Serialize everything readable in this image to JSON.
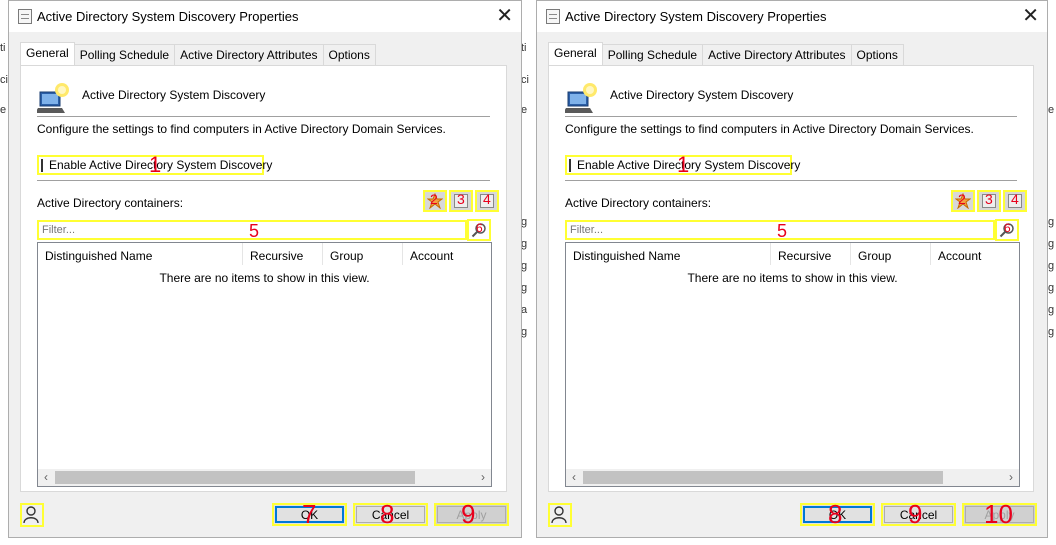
{
  "dialog1": {
    "title": "Active Directory System Discovery Properties",
    "close": "✕",
    "tabs": [
      "General",
      "Polling Schedule",
      "Active Directory Attributes",
      "Options"
    ],
    "header_label": "Active Directory System Discovery",
    "description": "Configure the settings to find computers in Active Directory Domain Services.",
    "enable_label": "Enable Active Directory System Discovery",
    "containers_label": "Active Directory containers:",
    "filter_placeholder": "Filter...",
    "columns": [
      "Distinguished Name",
      "Recursive",
      "Group",
      "Account"
    ],
    "empty_message": "There are no items to show in this view.",
    "buttons": {
      "ok": "OK",
      "cancel": "Cancel",
      "apply": "Apply"
    },
    "markers": {
      "enable": "1",
      "new": "2",
      "edit": "3",
      "delete": "4",
      "filter": "5",
      "search": "6",
      "ok": "7",
      "cancel": "8",
      "apply": "9"
    }
  },
  "dialog2": {
    "title": "Active Directory System Discovery Properties",
    "close": "✕",
    "tabs": [
      "General",
      "Polling Schedule",
      "Active Directory Attributes",
      "Options"
    ],
    "header_label": "Active Directory System Discovery",
    "description": "Configure the settings to find computers in Active Directory Domain Services.",
    "enable_label": "Enable Active Directory System Discovery",
    "containers_label": "Active Directory containers:",
    "filter_placeholder": "Filter...",
    "columns": [
      "Distinguished Name",
      "Recursive",
      "Group",
      "Account"
    ],
    "empty_message": "There are no items to show in this view.",
    "buttons": {
      "ok": "OK",
      "cancel": "Cancel",
      "apply": "Apply"
    },
    "markers": {
      "enable": "1",
      "new": "2",
      "edit": "3",
      "delete": "4",
      "filter": "5",
      "search": "6",
      "ok": "8",
      "cancel": "9",
      "apply": "10"
    }
  },
  "background": {
    "left_edge": [
      "ti",
      "ci",
      "e"
    ],
    "middle": [
      "ti",
      "ci",
      "e",
      "g",
      "g",
      "g",
      "g",
      "a",
      "g"
    ],
    "right_edge": [
      "e",
      "g",
      "g",
      "g",
      "g",
      "g",
      "g"
    ]
  },
  "colors": {
    "highlight": "#ffff33",
    "marker": "#e8001c",
    "default_button_border": "#0078d7"
  },
  "icons": {
    "title": "document-icon",
    "header": "ad-computer-icon",
    "search": "magnifier-icon",
    "bottom": "user-icon"
  }
}
